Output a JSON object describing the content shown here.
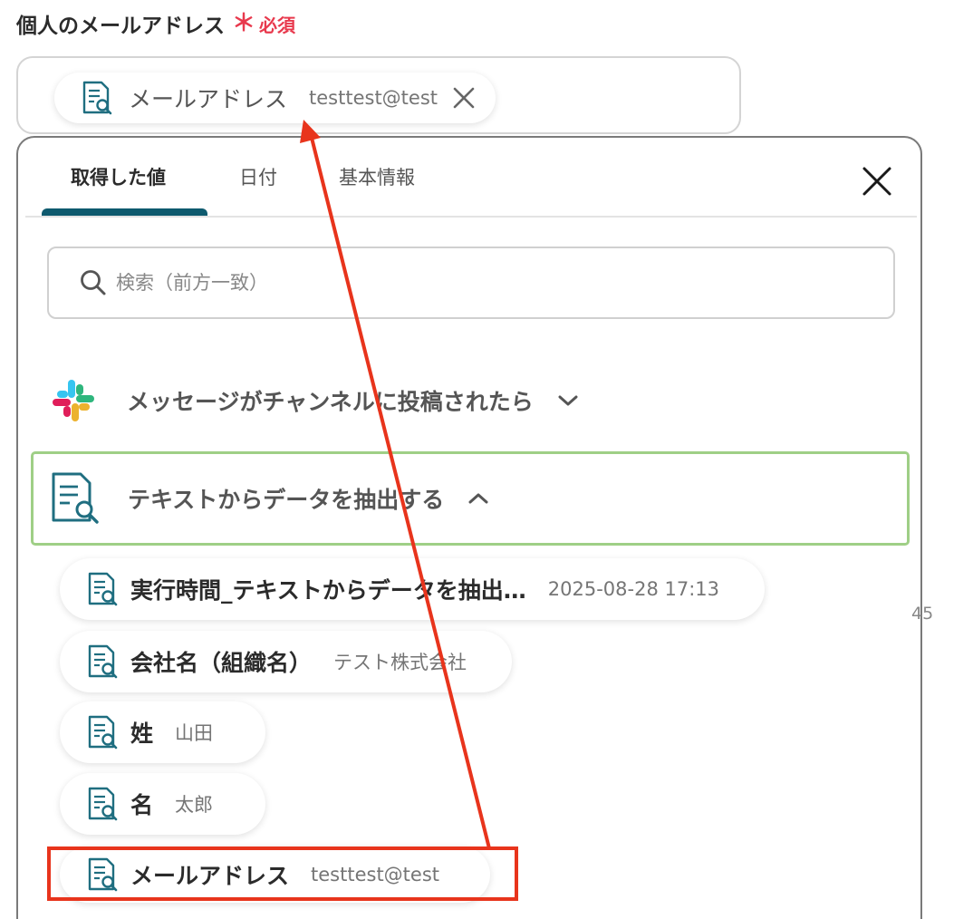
{
  "field": {
    "label": "個人のメールアドレス",
    "required_mark": "＊",
    "required_text": "必須",
    "selected": {
      "label": "メールアドレス",
      "value": "testtest@test"
    }
  },
  "panel": {
    "tabs": [
      {
        "label": "取得した値",
        "active": true
      },
      {
        "label": "日付",
        "active": false
      },
      {
        "label": "基本情報",
        "active": false
      }
    ],
    "search_placeholder": "検索（前方一致）",
    "sections": [
      {
        "label": "メッセージがチャンネルに投稿されたら",
        "icon": "slack-icon",
        "expanded": false
      },
      {
        "label": "テキストからデータを抽出する",
        "icon": "document-search-icon",
        "expanded": true
      }
    ],
    "items": [
      {
        "label": "実行時間_テキストからデータを抽出…",
        "value": "2025-08-28 17:13"
      },
      {
        "label": "会社名（組織名）",
        "value": "テスト株式会社"
      },
      {
        "label": "姓",
        "value": "山田"
      },
      {
        "label": "名",
        "value": "太郎"
      },
      {
        "label": "メールアドレス",
        "value": "testtest@test"
      }
    ]
  },
  "side_text": "45",
  "colors": {
    "accent": "#0e5a6e",
    "required": "#e8394d",
    "section_highlight": "#9fcf86",
    "annotation": "#e8341c"
  }
}
